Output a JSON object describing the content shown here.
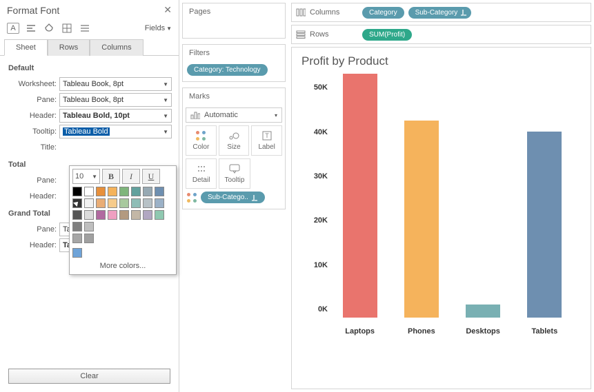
{
  "panel": {
    "title": "Format Font",
    "fields_label": "Fields",
    "tabs": {
      "sheet": "Sheet",
      "rows": "Rows",
      "columns": "Columns"
    },
    "sections": {
      "default": "Default",
      "total": "Total",
      "grand_total": "Grand Total"
    },
    "labels": {
      "worksheet": "Worksheet:",
      "pane": "Pane:",
      "header": "Header:",
      "tooltip": "Tooltip:",
      "title": "Title:"
    },
    "values": {
      "worksheet": "Tableau Book, 8pt",
      "def_pane": "Tableau Book, 8pt",
      "def_header": "Tableau Bold, 10pt",
      "def_tooltip": "Tableau Bold",
      "def_title": "",
      "tot_pane": "",
      "tot_header": "",
      "gt_pane": "Tableau Medium, 8pt",
      "gt_header": "Tableau Bold, 10pt"
    },
    "clear": "Clear"
  },
  "font_popup": {
    "size": "10",
    "more": "More colors...",
    "palette": {
      "bw_rows": [
        [
          "#000000",
          "#ffffff"
        ],
        [
          "#333333",
          "#f2f2f2"
        ],
        [
          "#555555",
          "#dcdcdc"
        ],
        [
          "#808080",
          "#bfbfbf"
        ],
        [
          "#a6a6a6",
          "#a0a0a0"
        ]
      ],
      "extra": "#6ea3d8",
      "color_rows": [
        [
          "#e7903c",
          "#f5b35c",
          "#7fb57c",
          "#62a19d",
          "#97a9b3",
          "#6e8fb0"
        ],
        [
          "#e9ad76",
          "#f6cb8c",
          "#a8c99e",
          "#8ebdb6",
          "#b7c1c6",
          "#9bb1c7"
        ],
        [
          "#b16aa0",
          "#ef9fc1",
          "#b39a80",
          "#c3b7a6",
          "#b1a7c2",
          "#8fc8b0"
        ]
      ]
    }
  },
  "cards": {
    "pages": "Pages",
    "filters": "Filters",
    "filter_pill": "Category: Technology",
    "marks": "Marks",
    "marks_type": "Automatic",
    "color": "Color",
    "size": "Size",
    "label": "Label",
    "detail": "Detail",
    "tooltip": "Tooltip",
    "subcat_pill": "Sub-Catego.."
  },
  "shelves": {
    "columns": "Columns",
    "rows": "Rows",
    "cat": "Category",
    "subcat": "Sub-Category",
    "profit": "SUM(Profit)"
  },
  "chart_data": {
    "type": "bar",
    "title": "Profit by Product",
    "ylabel": "",
    "xlabel": "",
    "ylim": [
      0,
      55000
    ],
    "yticks": [
      "0K",
      "10K",
      "20K",
      "30K",
      "40K",
      "50K"
    ],
    "categories": [
      "Laptops",
      "Phones",
      "Desktops",
      "Tablets"
    ],
    "values": [
      55000,
      44500,
      3000,
      42000
    ],
    "colors": [
      "#e9746d",
      "#f5b35c",
      "#79b0b3",
      "#6e8fb0"
    ]
  }
}
